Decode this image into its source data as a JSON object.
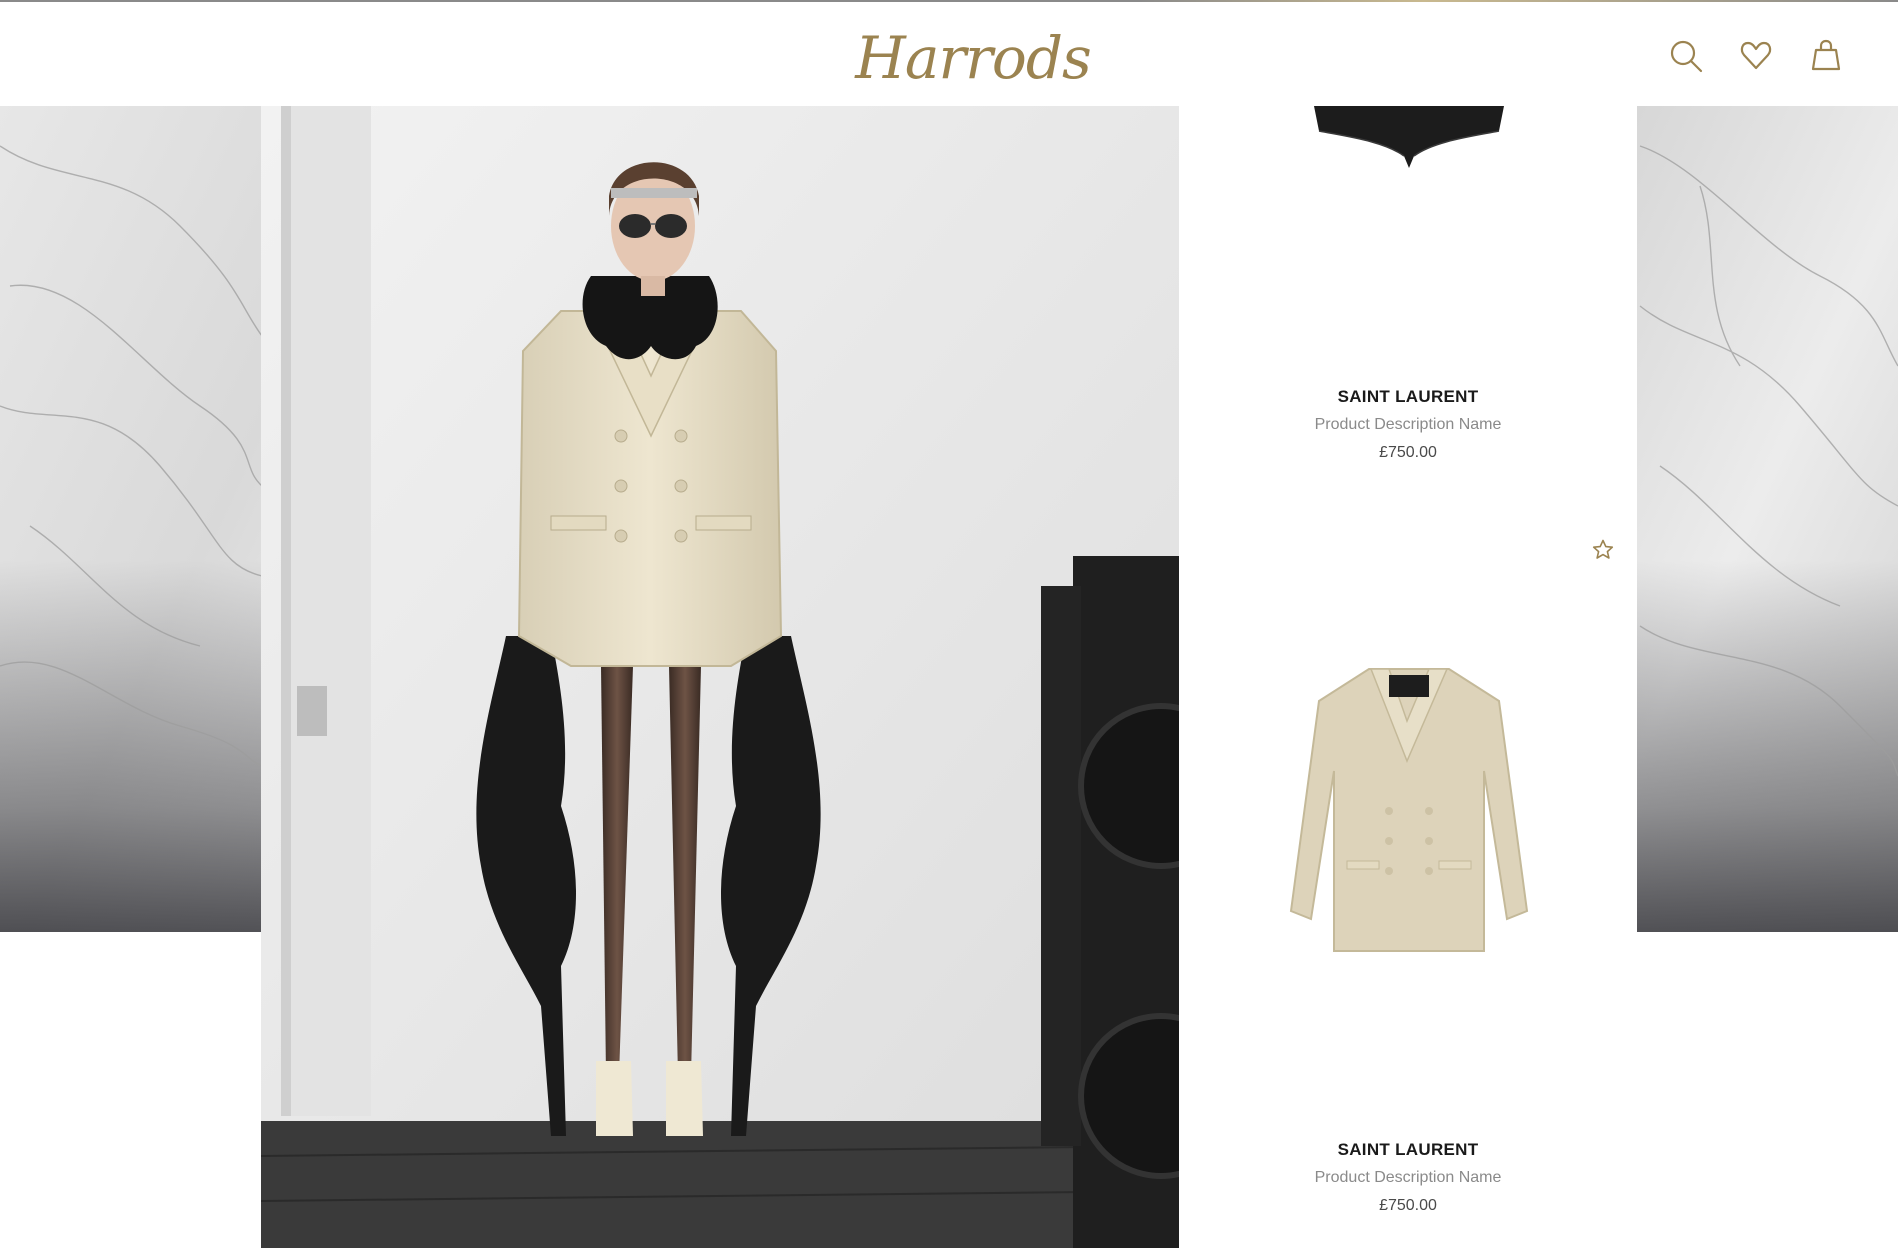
{
  "header": {
    "logo_text": "Harrods",
    "icons": [
      "search-icon",
      "heart-icon",
      "bag-icon"
    ],
    "accent_color": "#9b8350"
  },
  "products": [
    {
      "brand": "SAINT LAURENT",
      "description": "Product Description Name",
      "price": "£750.00"
    },
    {
      "brand": "SAINT LAURENT",
      "description": "Product Description Name",
      "price": "£750.00"
    }
  ]
}
